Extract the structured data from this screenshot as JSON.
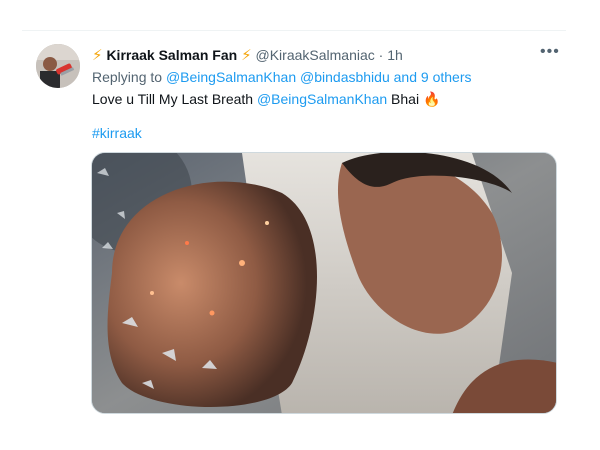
{
  "tweet": {
    "display_name": "Kirraak Salman Fan",
    "handle": "@KiraakSalmaniac",
    "separator": "·",
    "time": "1h",
    "more_label": "•••",
    "replying_label": "Replying to",
    "reply_to": [
      "@BeingSalmanKhan",
      "@bindasbhidu"
    ],
    "reply_others": "and 9 others",
    "text_before": "Love u Till My Last Breath",
    "text_mention": "@BeingSalmanKhan",
    "text_after": "Bhai",
    "hashtag": "#kirraak"
  },
  "icons": {
    "name_prefix": "lightning-bolt-emoji-icon",
    "name_suffix": "lightning-bolt-emoji-icon",
    "end_of_text": "fire-emoji-icon",
    "more": "more-dots-icon"
  },
  "colors": {
    "link": "#1d9bf0",
    "muted": "#536471",
    "text": "#0f1419"
  }
}
